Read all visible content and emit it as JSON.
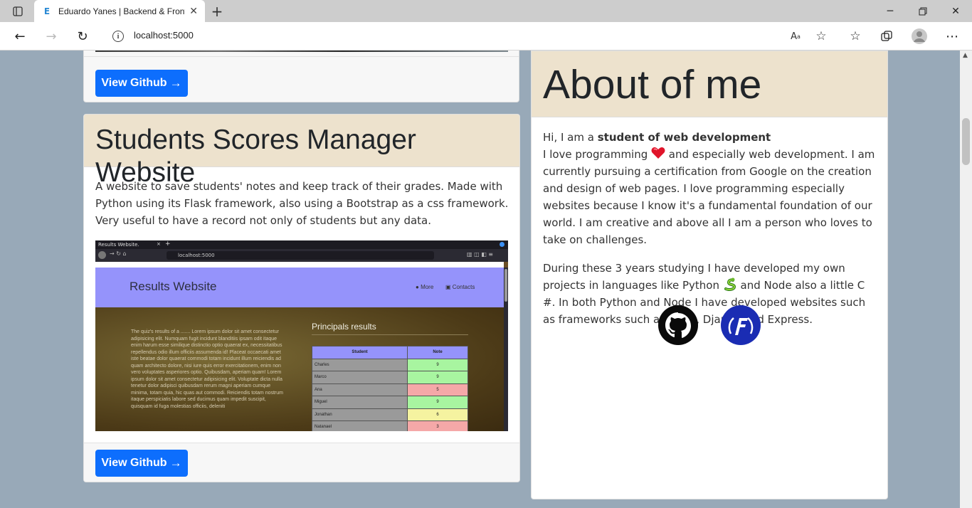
{
  "browser": {
    "tab_title": "Eduardo Yanes | Backend & Frontend",
    "tab_favicon": "E",
    "url": "localhost:5000",
    "icons": [
      "tab-actions-icon",
      "close-icon",
      "new-tab-icon",
      "minimize-icon",
      "restore-icon",
      "window-close-icon",
      "back-icon",
      "forward-icon",
      "refresh-icon",
      "info-icon",
      "read-aloud-icon",
      "add-favorite-icon",
      "favorites-icon",
      "collections-icon",
      "profile-icon",
      "more-icon"
    ]
  },
  "projects": {
    "top_card": {
      "button_label": "View Github",
      "button_arrow": "→"
    },
    "students_card": {
      "title": "Students Scores Manager Website",
      "description": "A website to save students' notes and keep track of their grades. Made with Python using its Flask framework, also using a Bootstrap as a css framework. Very useful to have a record not only of students but any data.",
      "button_label": "View Github",
      "button_arrow": "→",
      "screenshot": {
        "tab_title": "Results Website.",
        "url": "localhost:5000",
        "brand": "Results Website",
        "nav_more": "More",
        "nav_contacts": "Contacts",
        "intro": "The quiz's results of a ....... Lorem ipsum dolor sit amet consectetur adipisicing elit. Numquam fugit incidunt blanditiis ipsam odit itaque enim harum esse similique distinctio optio quaerat ex, necessitatibus repellendus odio illum officiis assumenda id! Placeat occaecati amet iste beatae dolor quaerat commodi totam incidunt illum reiciendis ad quam architecto dolore, nisi iure quis error exercitationem, enim non vero voluptates asperiores optio. Quibusdam, aperiam quam! Lorem ipsum dolor sit amet consectetur adipisicing elit. Voluptate dicta nulla tenetur dolor adipisci quibusdam rerum magni aperiam cumque minima, totam quia, hic quas aut commodi. Reiciendis totam nostrum itaque perspiciatis labore sed ducimus quam impedit suscipit, quisquam id fuga molestias officiis, deleniti",
        "results_title": "Principals results",
        "col_student": "Student",
        "col_note": "Note",
        "rows": [
          {
            "name": "Charles",
            "note": "9",
            "color": "#a8f5a0"
          },
          {
            "name": "Marco",
            "note": "9",
            "color": "#a8f5a0"
          },
          {
            "name": "Ana",
            "note": "5",
            "color": "#f5a8a8"
          },
          {
            "name": "Miguel",
            "note": "9",
            "color": "#a8f5a0"
          },
          {
            "name": "Jonathan",
            "note": "6",
            "color": "#f5f3a0"
          },
          {
            "name": "Natanael",
            "note": "3",
            "color": "#f5a8a8"
          }
        ]
      }
    }
  },
  "about": {
    "title": "About of me",
    "intro_prefix": "Hi, I am a ",
    "intro_bold": "student of web development",
    "p1_a": "I love programming ",
    "p1_emoji": "heart-icon",
    "p1_b": " and especially web development. I am currently pursuing a certification from Google on the creation and design of web pages. I love programming especially websites because I know it's a fundamental foundation of our world. I am creative and above all I am a person who loves to take on challenges.",
    "p2_a": "During these 3 years studying I have developed my own projects in languages like Python ",
    "p2_emoji": "snake-icon",
    "p2_b": " and Node also a little C #. In both Python and Node I have developed websites such as frameworks such as Flask, Django and Express.",
    "social": [
      "github-icon",
      "freecodecamp-icon"
    ]
  },
  "colors": {
    "accent": "#0d6efd",
    "header_bg": "#ede2cd",
    "page_bg": "#98a9b8"
  }
}
